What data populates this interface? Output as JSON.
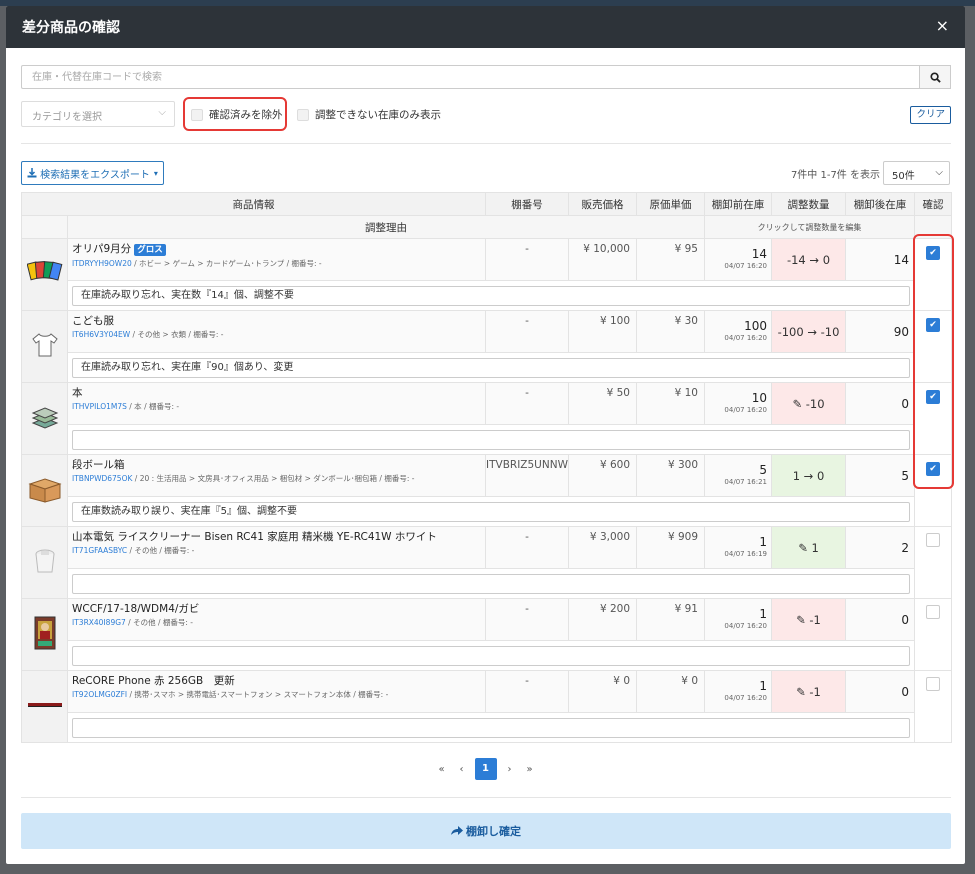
{
  "modal": {
    "title": "差分商品の確認",
    "close": "×"
  },
  "search": {
    "placeholder": "在庫・代替在庫コードで検索"
  },
  "filters": {
    "category_placeholder": "カテゴリを選択",
    "exclude_confirmed": "確認済みを除外",
    "only_unadjustable": "調整できない在庫のみ表示",
    "clear": "クリア"
  },
  "toolbar": {
    "export": "検索結果をエクスポート",
    "count": "7件中 1-7件 を表示",
    "per_page": "50件"
  },
  "table": {
    "headers": {
      "product": "商品情報",
      "shelf": "棚番号",
      "price": "販売価格",
      "cost": "原価単価",
      "before": "棚卸前在庫",
      "adjust": "調整数量",
      "after": "棚卸後在庫",
      "confirm": "確認",
      "reason": "調整理由",
      "adjust_hint": "クリックして調整数量を編集"
    },
    "rows": [
      {
        "name": "オリパ9月分",
        "badge": "グロス",
        "code": "ITDRYYH9OW20",
        "meta": " / ホビー > ゲーム > カードゲーム･トランプ / 棚番号: -",
        "shelf": "-",
        "price": "¥ 10,000",
        "cost": "¥ 95",
        "before": "14",
        "date": "04/07 16:20",
        "adjust": "-14 → 0",
        "adjust_bg": "red",
        "after": "14",
        "checked": true,
        "reason": "在庫読み取り忘れ、実在数『14』個、調整不要",
        "icon": "card-pack-icon"
      },
      {
        "name": "こども服",
        "badge": "",
        "code": "IT6H6V3Y04EW",
        "meta": " / その他 > 衣類 / 棚番号: -",
        "shelf": "-",
        "price": "¥ 100",
        "cost": "¥ 30",
        "before": "100",
        "date": "04/07 16:20",
        "adjust": "-100 → -10",
        "adjust_bg": "red",
        "after": "90",
        "checked": true,
        "reason": "在庫読み取り忘れ、実在庫『90』個あり、変更",
        "icon": "tshirt-icon"
      },
      {
        "name": "本",
        "badge": "",
        "code": "ITHVPILO1M7S",
        "meta": " / 本 / 棚番号: -",
        "shelf": "-",
        "price": "¥ 50",
        "cost": "¥ 10",
        "before": "10",
        "date": "04/07 16:20",
        "adjust": "✎ -10",
        "adjust_bg": "red",
        "after": "0",
        "checked": true,
        "reason": "",
        "icon": "books-icon"
      },
      {
        "name": "段ボール箱",
        "badge": "",
        "code": "ITBNPWD675OK",
        "meta": " / 20 : 生活用品 > 文房具･オフィス用品 > 梱包材 > ダンボール･梱包箱 / 棚番号: -",
        "shelf": "ITVBRIZ5UNNW",
        "price": "¥ 600",
        "cost": "¥ 300",
        "before": "5",
        "date": "04/07 16:21",
        "adjust": "1 → 0",
        "adjust_bg": "green",
        "after": "5",
        "checked": true,
        "reason": "在庫数読み取り誤り、実在庫『5』個、調整不要",
        "icon": "cardboard-box-icon"
      },
      {
        "name": "山本電気 ライスクリーナー Bisen RC41 家庭用 精米機 YE-RC41W ホワイト",
        "badge": "",
        "code": "IT71GFAASBYC",
        "meta": " / その他 / 棚番号: -",
        "shelf": "-",
        "price": "¥ 3,000",
        "cost": "¥ 909",
        "before": "1",
        "date": "04/07 16:19",
        "adjust": "✎ 1",
        "adjust_bg": "green",
        "after": "2",
        "checked": false,
        "reason": "",
        "icon": "rice-cleaner-icon"
      },
      {
        "name": "WCCF/17-18/WDM4/ガビ",
        "badge": "",
        "code": "IT3RX40I89G7",
        "meta": " / その他 / 棚番号: -",
        "shelf": "-",
        "price": "¥ 200",
        "cost": "¥ 91",
        "before": "1",
        "date": "04/07 16:20",
        "adjust": "✎ -1",
        "adjust_bg": "red",
        "after": "0",
        "checked": false,
        "reason": "",
        "icon": "trading-card-icon"
      },
      {
        "name": "ReCORE Phone 赤 256GB　更新",
        "badge": "",
        "code": "IT92OLMG0ZFI",
        "meta": " / 携帯･スマホ > 携帯電話･スマートフォン > スマートフォン本体 / 棚番号: -",
        "shelf": "-",
        "price": "¥ 0",
        "cost": "¥ 0",
        "before": "1",
        "date": "04/07 16:20",
        "adjust": "✎ -1",
        "adjust_bg": "red",
        "after": "0",
        "checked": false,
        "reason": "",
        "icon": "phone-icon"
      }
    ]
  },
  "pagination": {
    "first": "«",
    "prev": "‹",
    "current": "1",
    "next": "›",
    "last": "»"
  },
  "footer": {
    "confirm": "棚卸し確定"
  },
  "colors": {
    "header_bg": "#2d3339",
    "accent": "#2c7dd6",
    "adjust_red": "#fde8e8",
    "adjust_green": "#e8f5e1",
    "highlight": "#e53935",
    "confirm_btn_bg": "#cfe6f8"
  }
}
